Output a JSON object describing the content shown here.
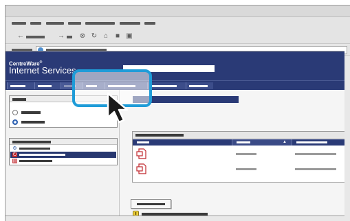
{
  "banner": {
    "brand_name": "CentreWare",
    "brand_mark": "®",
    "brand_product": "Internet Services"
  },
  "colors": {
    "banner": "#2a3a76",
    "highlight": "#1f9cd8",
    "selected_nav": "#27376f",
    "doc_icon": "#c0272d",
    "page_background": "#f5f5f5"
  },
  "icons": {
    "toolbar": [
      "back-arrow-icon",
      "forward-arrow-icon",
      "stop-icon",
      "refresh-icon",
      "home-icon",
      "folder-icon",
      "print-icon"
    ],
    "address": "globe-icon",
    "left_nav": [
      "settings-icon",
      "power-icon",
      "printer-icon"
    ],
    "documents": [
      "document-icon",
      "document-icon"
    ],
    "note": "info-icon",
    "pointer": "mouse-cursor-icon"
  },
  "tabs": {
    "selected_index": 2
  },
  "table": {
    "sort": "ascending"
  },
  "radio": {
    "selected_index": 1
  },
  "left_nav": {
    "selected_index": 1
  }
}
